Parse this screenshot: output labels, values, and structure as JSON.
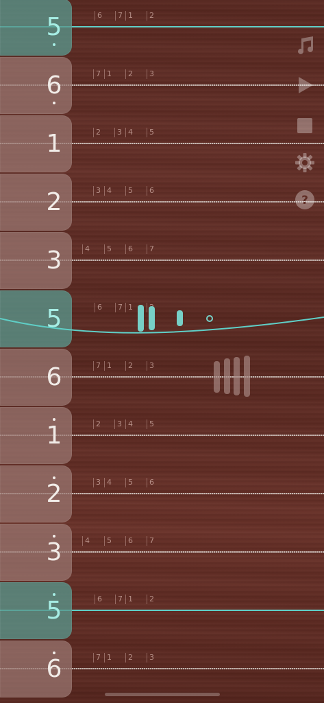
{
  "app": {
    "keys": [
      {
        "label": "5",
        "octave": "low",
        "active": true,
        "hints": [
          {
            "text": "6"
          },
          {
            "text": "7"
          },
          {
            "text": "1",
            "dot": "top"
          },
          {
            "text": "2",
            "dot": "top"
          }
        ]
      },
      {
        "label": "6",
        "octave": "low",
        "active": false,
        "hints": [
          {
            "text": "7"
          },
          {
            "text": "1",
            "dot": "top"
          },
          {
            "text": "2",
            "dot": "top"
          },
          {
            "text": "3",
            "dot": "top"
          }
        ]
      },
      {
        "label": "1",
        "octave": "mid",
        "active": false,
        "hints": [
          {
            "text": "2"
          },
          {
            "text": "3"
          },
          {
            "text": "4"
          },
          {
            "text": "5"
          }
        ]
      },
      {
        "label": "2",
        "octave": "mid",
        "active": false,
        "hints": [
          {
            "text": "3"
          },
          {
            "text": "4"
          },
          {
            "text": "5"
          },
          {
            "text": "6"
          }
        ]
      },
      {
        "label": "3",
        "octave": "mid",
        "active": false,
        "hints": [
          {
            "text": "4"
          },
          {
            "text": "5"
          },
          {
            "text": "6"
          },
          {
            "text": "7"
          }
        ]
      },
      {
        "label": "5",
        "octave": "mid",
        "active": true,
        "hints": [
          {
            "text": "6"
          },
          {
            "text": "7"
          },
          {
            "text": "1",
            "dot": "top"
          },
          {
            "text": "2",
            "dot": "top"
          }
        ]
      },
      {
        "label": "6",
        "octave": "mid",
        "active": false,
        "hints": [
          {
            "text": "7"
          },
          {
            "text": "1",
            "dot": "top"
          },
          {
            "text": "2",
            "dot": "top"
          },
          {
            "text": "3",
            "dot": "top"
          }
        ]
      },
      {
        "label": "1",
        "octave": "high",
        "active": false,
        "hints": [
          {
            "text": "2",
            "dot": "top"
          },
          {
            "text": "3",
            "dot": "top"
          },
          {
            "text": "4",
            "dot": "top"
          },
          {
            "text": "5",
            "dot": "top"
          }
        ]
      },
      {
        "label": "2",
        "octave": "high",
        "active": false,
        "hints": [
          {
            "text": "3",
            "dot": "top"
          },
          {
            "text": "4",
            "dot": "top"
          },
          {
            "text": "5",
            "dot": "top"
          },
          {
            "text": "6",
            "dot": "top"
          }
        ]
      },
      {
        "label": "3",
        "octave": "high",
        "active": false,
        "hints": [
          {
            "text": "4",
            "dot": "top"
          },
          {
            "text": "5",
            "dot": "top"
          },
          {
            "text": "6",
            "dot": "top"
          },
          {
            "text": "7",
            "dot": "top"
          }
        ]
      },
      {
        "label": "5",
        "octave": "high",
        "active": true,
        "hints": [
          {
            "text": "6",
            "dot": "top"
          },
          {
            "text": "7",
            "dot": "top"
          },
          {
            "text": "1",
            "dot": "top"
          },
          {
            "text": "2",
            "dot": "top"
          }
        ]
      },
      {
        "label": "6",
        "octave": "high",
        "active": false,
        "hints": [
          {
            "text": "7",
            "dot": "top"
          },
          {
            "text": "1",
            "dot": "top"
          },
          {
            "text": "2",
            "dot": "top"
          },
          {
            "text": "3",
            "dot": "top"
          }
        ]
      }
    ],
    "toolbar": [
      {
        "icon": "music-note-icon"
      },
      {
        "icon": "play-icon"
      },
      {
        "icon": "stop-icon"
      },
      {
        "icon": "gear-icon"
      },
      {
        "icon": "help-icon"
      }
    ],
    "colors": {
      "wood": "#5f2c24",
      "key": "#9b7873",
      "key_active": "#5a968c",
      "string_active": "#5fcfc7",
      "accent": "#7fd8cf"
    }
  }
}
